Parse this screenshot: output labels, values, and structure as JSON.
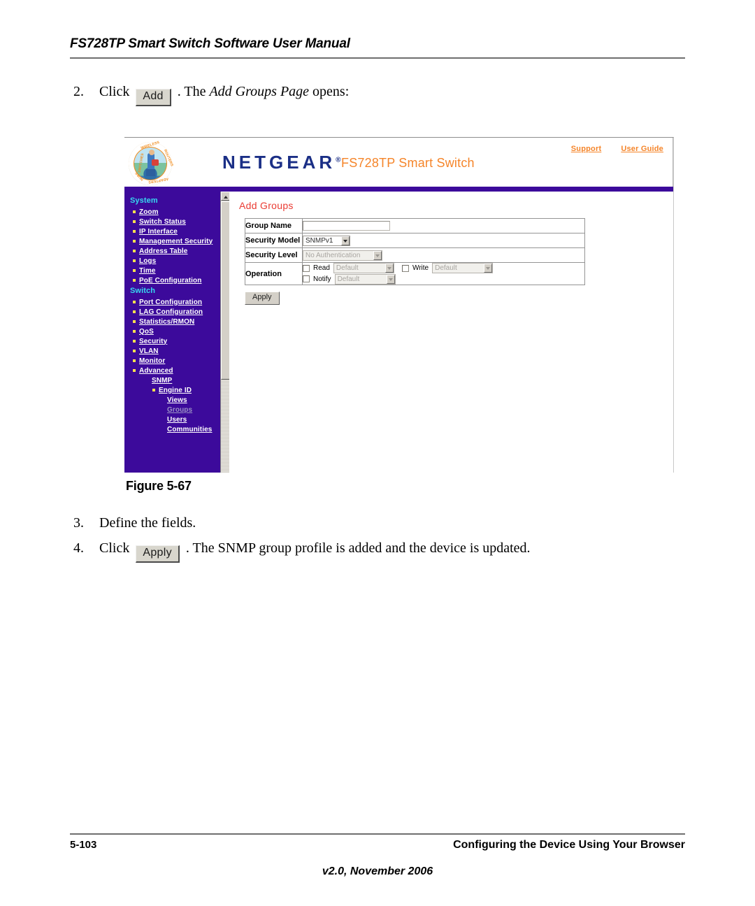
{
  "document": {
    "header_title": "FS728TP Smart Switch Software User Manual",
    "figure_caption": "Figure 5-67",
    "footer": {
      "page_number": "5-103",
      "chapter": "Configuring the Device Using Your Browser",
      "version": "v2.0, November 2006"
    }
  },
  "steps": [
    {
      "number": "2.",
      "before": "Click",
      "button": "Add",
      "after_plain_1": ". The ",
      "after_italic": "Add Groups Page",
      "after_plain_2": " opens:"
    },
    {
      "number": "3.",
      "text": "Define the fields."
    },
    {
      "number": "4.",
      "before": "Click",
      "button": "Apply",
      "after": ". The SNMP group profile is added and the device is updated."
    }
  ],
  "screenshot": {
    "brand": {
      "wordmark": "NETGEAR",
      "trademark": "®",
      "model": "FS728TP Smart Switch",
      "logo_ring_words": [
        "SWITCHES",
        "WIRELESS",
        "ROUTERS",
        "ADAPTERS",
        "HUBS"
      ],
      "links": [
        {
          "label": "Support",
          "name": "support-link"
        },
        {
          "label": "User Guide",
          "name": "user-guide-link"
        }
      ]
    },
    "nav": [
      {
        "type": "group",
        "label": "System"
      },
      {
        "type": "item",
        "label": "Zoom",
        "level": 1,
        "bullet": true,
        "current": false
      },
      {
        "type": "item",
        "label": "Switch Status",
        "level": 1,
        "bullet": true,
        "current": false
      },
      {
        "type": "item",
        "label": "IP Interface",
        "level": 1,
        "bullet": true,
        "current": false
      },
      {
        "type": "item",
        "label": "Management Security",
        "level": 1,
        "bullet": true,
        "current": false
      },
      {
        "type": "item",
        "label": "Address Table",
        "level": 1,
        "bullet": true,
        "current": false
      },
      {
        "type": "item",
        "label": "Logs",
        "level": 1,
        "bullet": true,
        "current": false
      },
      {
        "type": "item",
        "label": "Time",
        "level": 1,
        "bullet": true,
        "current": false
      },
      {
        "type": "item",
        "label": "PoE Configuration",
        "level": 1,
        "bullet": true,
        "current": false
      },
      {
        "type": "group",
        "label": "Switch"
      },
      {
        "type": "item",
        "label": "Port Configuration",
        "level": 1,
        "bullet": true,
        "current": false
      },
      {
        "type": "item",
        "label": "LAG Configuration",
        "level": 1,
        "bullet": true,
        "current": false
      },
      {
        "type": "item",
        "label": "Statistics/RMON",
        "level": 1,
        "bullet": true,
        "current": false
      },
      {
        "type": "item",
        "label": "QoS",
        "level": 1,
        "bullet": true,
        "current": false
      },
      {
        "type": "item",
        "label": "Security",
        "level": 1,
        "bullet": true,
        "current": false
      },
      {
        "type": "item",
        "label": "VLAN",
        "level": 1,
        "bullet": true,
        "current": false
      },
      {
        "type": "item",
        "label": "Monitor",
        "level": 1,
        "bullet": true,
        "current": false
      },
      {
        "type": "item",
        "label": "Advanced",
        "level": 1,
        "bullet": true,
        "current": false
      },
      {
        "type": "item",
        "label": "SNMP",
        "level": 2,
        "bullet": false,
        "current": false
      },
      {
        "type": "item",
        "label": "Engine ID",
        "level": 3,
        "bullet": true,
        "current": false
      },
      {
        "type": "item",
        "label": "Views",
        "level": 4,
        "bullet": false,
        "current": false
      },
      {
        "type": "item",
        "label": "Groups",
        "level": 4,
        "bullet": false,
        "current": true
      },
      {
        "type": "item",
        "label": "Users",
        "level": 4,
        "bullet": false,
        "current": false
      },
      {
        "type": "item",
        "label": "Communities",
        "level": 4,
        "bullet": false,
        "current": false
      }
    ],
    "page": {
      "title": "Add Groups",
      "fields": [
        {
          "label": "Group Name",
          "control": "textbox",
          "value": ""
        },
        {
          "label": "Security Model",
          "control": "select",
          "value": "SNMPv1",
          "disabled": false
        },
        {
          "label": "Security Level",
          "control": "select",
          "value": "No Authentication",
          "disabled": true
        },
        {
          "label": "Operation",
          "control": "operations"
        }
      ],
      "operations": [
        {
          "label": "Read",
          "checked": false,
          "value": "Default",
          "disabled": true
        },
        {
          "label": "Write",
          "checked": false,
          "value": "Default",
          "disabled": true
        },
        {
          "label": "Notify",
          "checked": false,
          "value": "Default",
          "disabled": true
        }
      ],
      "apply_label": "Apply"
    },
    "colors": {
      "nav_background": "#3c0a9b",
      "nav_group_text": "#36d8f0",
      "page_title": "#ea3b33",
      "brand_orange": "#f5852a",
      "netgear_blue": "#1b2f86"
    }
  }
}
